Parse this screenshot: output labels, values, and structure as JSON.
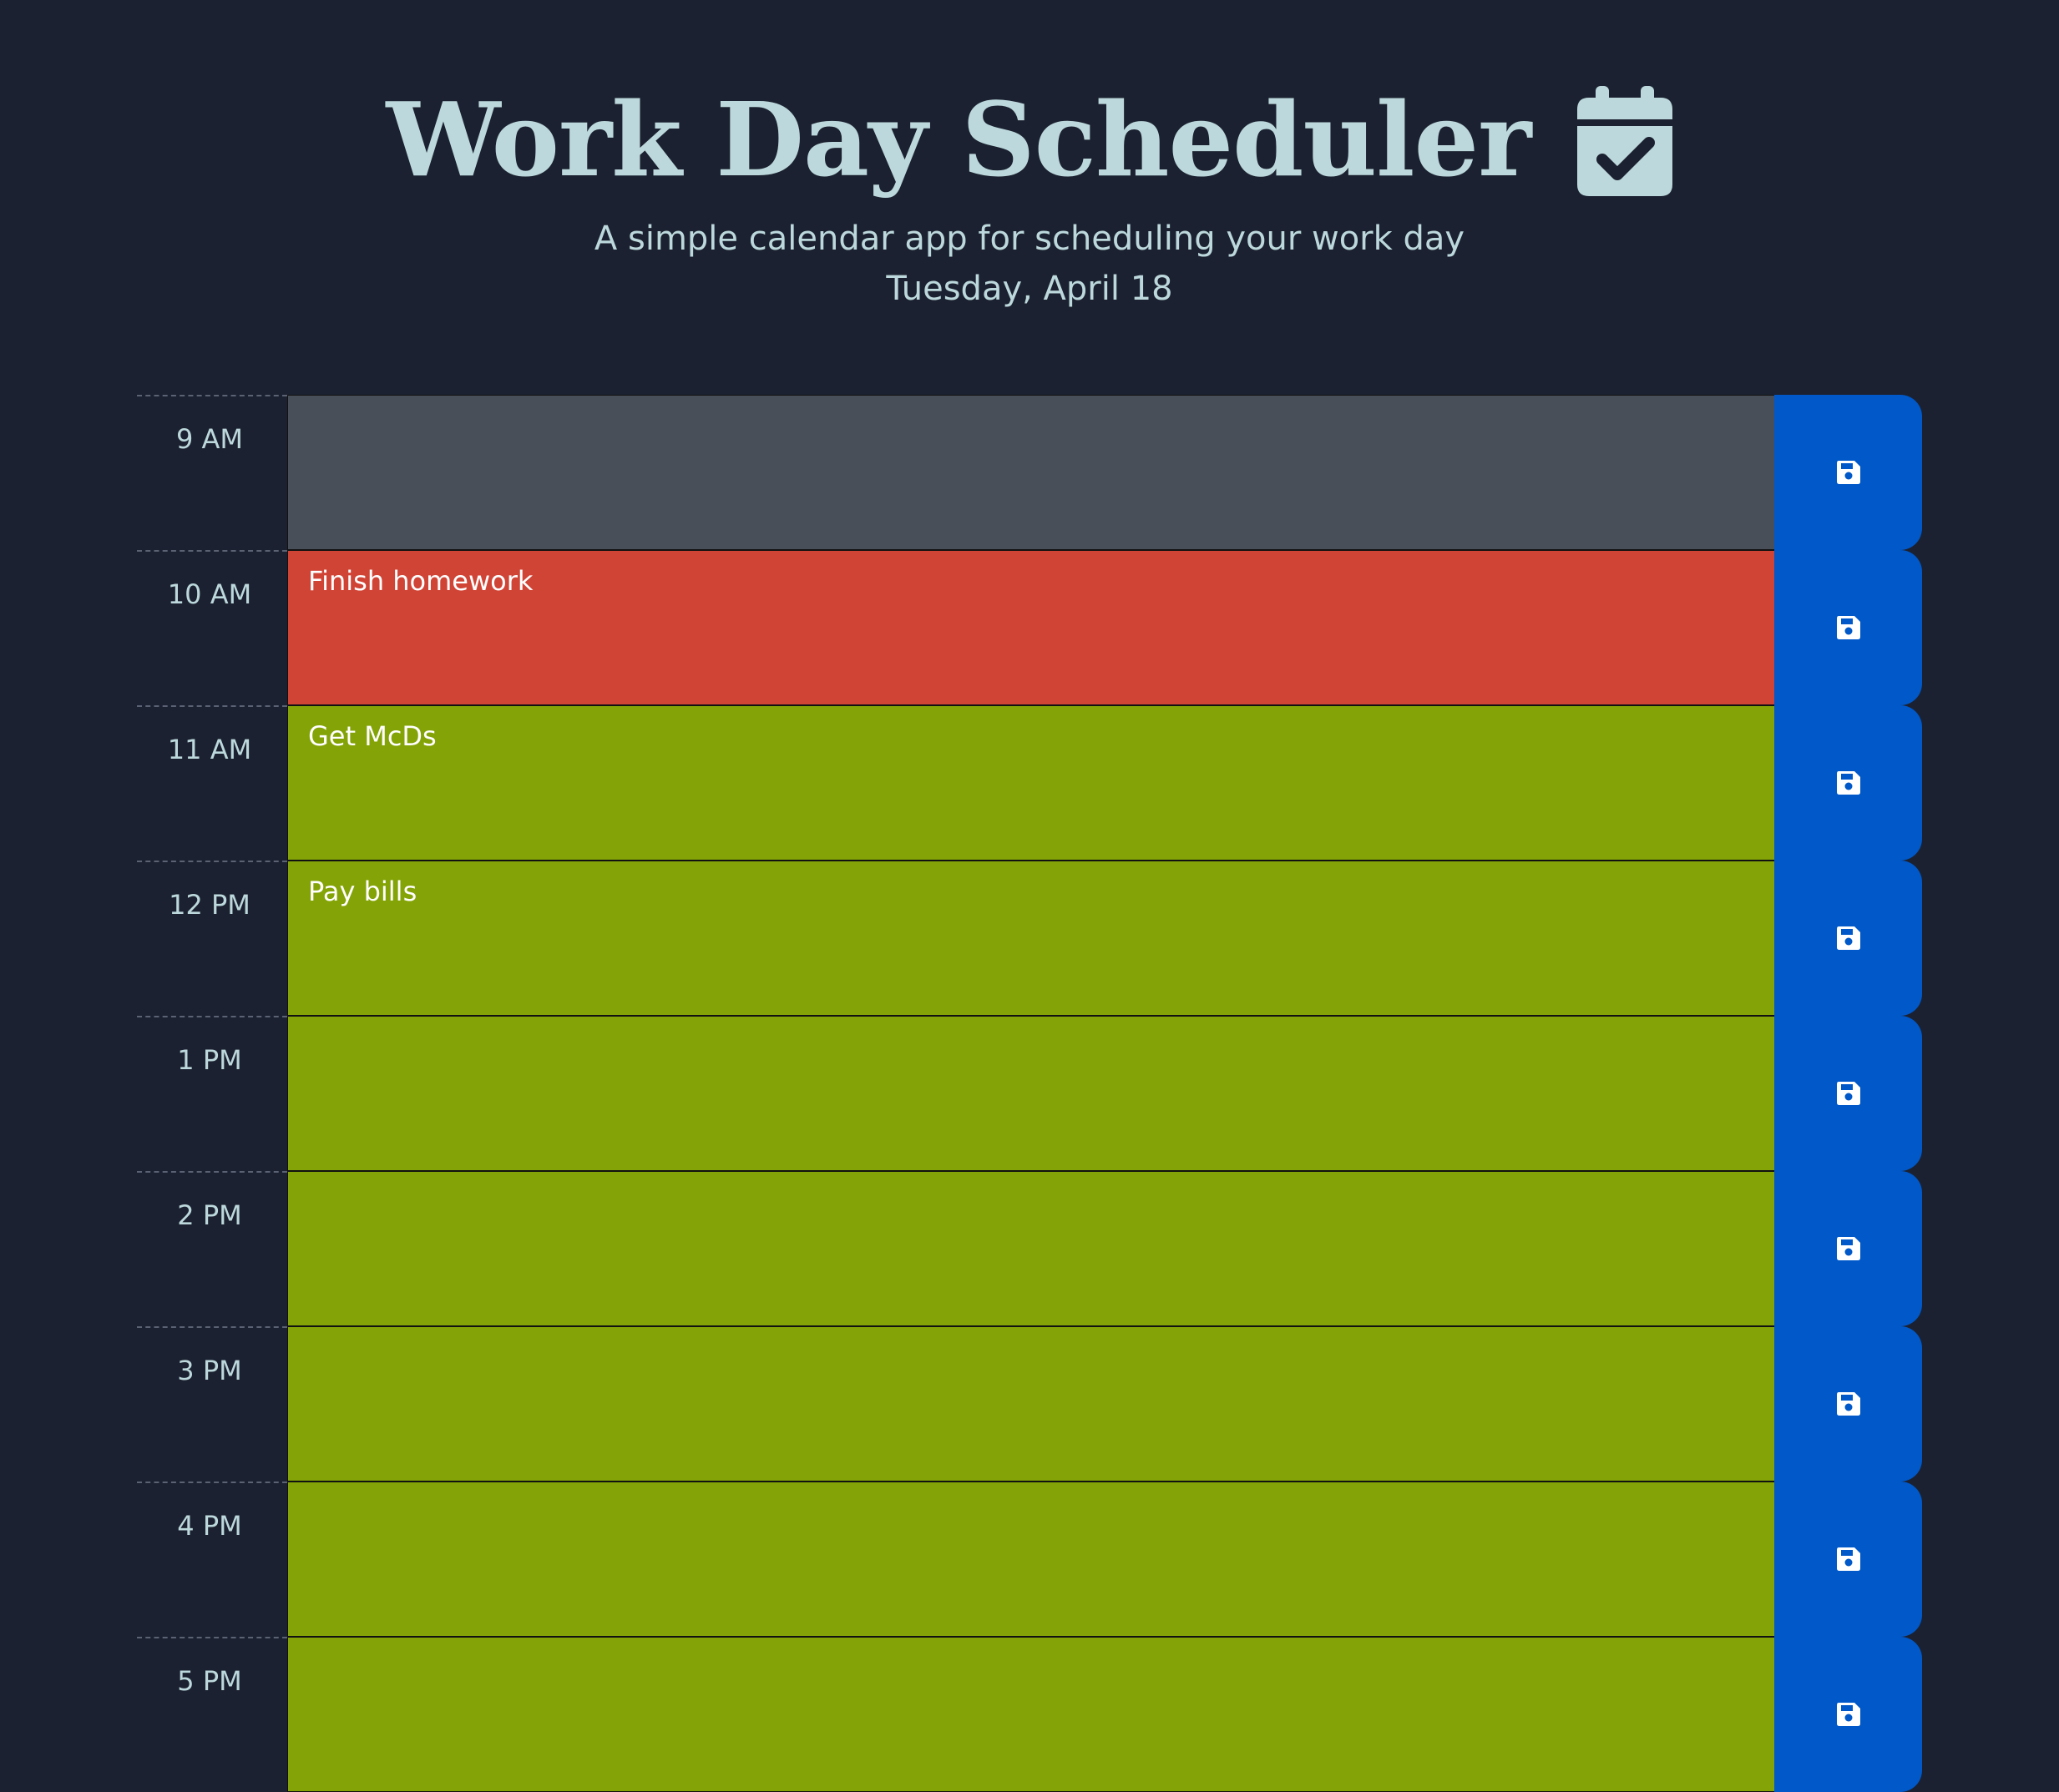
{
  "header": {
    "title": "Work Day Scheduler",
    "title_icon": "calendar-check-icon",
    "subtitle": "A simple calendar app for scheduling your work day",
    "current_date": "Tuesday, April 18"
  },
  "colors": {
    "background": "#1b2130",
    "past": "#494f58",
    "present": "#d04436",
    "future": "#83a306",
    "save_button": "#0058c9",
    "text_light": "#bcd8dc"
  },
  "schedule": [
    {
      "hour": "9 AM",
      "text": "",
      "state": "past",
      "save_icon": "save-icon"
    },
    {
      "hour": "10 AM",
      "text": "Finish homework",
      "state": "present",
      "save_icon": "save-icon"
    },
    {
      "hour": "11 AM",
      "text": "Get McDs",
      "state": "future",
      "save_icon": "save-icon"
    },
    {
      "hour": "12 PM",
      "text": "Pay bills",
      "state": "future",
      "save_icon": "save-icon"
    },
    {
      "hour": "1 PM",
      "text": "",
      "state": "future",
      "save_icon": "save-icon"
    },
    {
      "hour": "2 PM",
      "text": "",
      "state": "future",
      "save_icon": "save-icon"
    },
    {
      "hour": "3 PM",
      "text": "",
      "state": "future",
      "save_icon": "save-icon"
    },
    {
      "hour": "4 PM",
      "text": "",
      "state": "future",
      "save_icon": "save-icon"
    },
    {
      "hour": "5 PM",
      "text": "",
      "state": "future",
      "save_icon": "save-icon"
    }
  ]
}
